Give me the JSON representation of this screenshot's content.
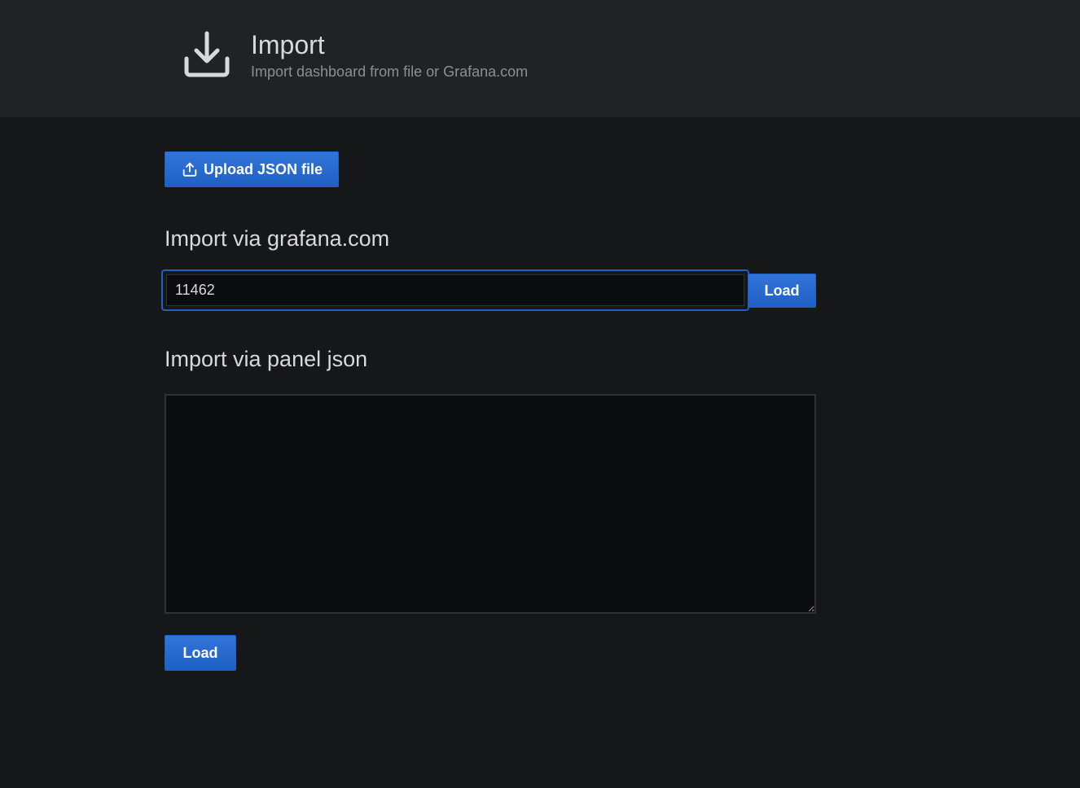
{
  "header": {
    "title": "Import",
    "subtitle": "Import dashboard from file or Grafana.com",
    "icon": "download-icon"
  },
  "upload": {
    "label": "Upload JSON file",
    "icon": "upload-icon"
  },
  "grafana_com": {
    "title": "Import via grafana.com",
    "input_value": "11462",
    "load_label": "Load"
  },
  "panel_json": {
    "title": "Import via panel json",
    "textarea_value": "",
    "load_label": "Load"
  },
  "colors": {
    "background": "#161719",
    "header_background": "#212226",
    "primary_button": "#3274d9",
    "focus_border": "#1f60c4"
  }
}
